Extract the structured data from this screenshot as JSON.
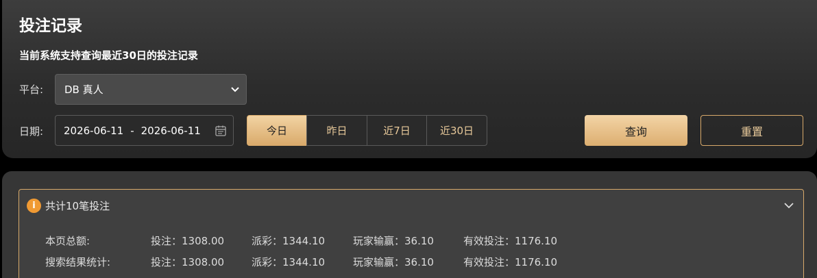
{
  "header": {
    "title": "投注记录",
    "subtitle": "当前系统支持查询最近30日的投注记录"
  },
  "filters": {
    "platform_label": "平台:",
    "platform_value": "DB 真人",
    "date_label": "日期:",
    "date_start": "2026-06-11",
    "date_sep": "-",
    "date_end": "2026-06-11",
    "quick_ranges": [
      {
        "label": "今日",
        "active": true
      },
      {
        "label": "昨日",
        "active": false
      },
      {
        "label": "近7日",
        "active": false
      },
      {
        "label": "近30日",
        "active": false
      }
    ],
    "query_label": "查询",
    "reset_label": "重置"
  },
  "summary": {
    "title": "共计10笔投注",
    "rows": [
      {
        "label": "本页总额:",
        "bet": "投注：1308.00",
        "payout": "派彩：1344.10",
        "player_win": "玩家输赢：36.10",
        "valid_bet": "有效投注：1176.10"
      },
      {
        "label": "搜索结果统计:",
        "bet": "投注：1308.00",
        "payout": "派彩：1344.10",
        "player_win": "玩家输赢：36.10",
        "valid_bet": "有效投注：1176.10"
      }
    ]
  },
  "colors": {
    "accent": "#d9aa6b",
    "accent_light": "#f2d3a3",
    "info": "#f09a33",
    "panel": "#363636"
  },
  "icons": {
    "select": "chevron-down-icon",
    "date": "calendar-icon",
    "info": "info-icon",
    "collapse": "chevron-down-icon"
  }
}
